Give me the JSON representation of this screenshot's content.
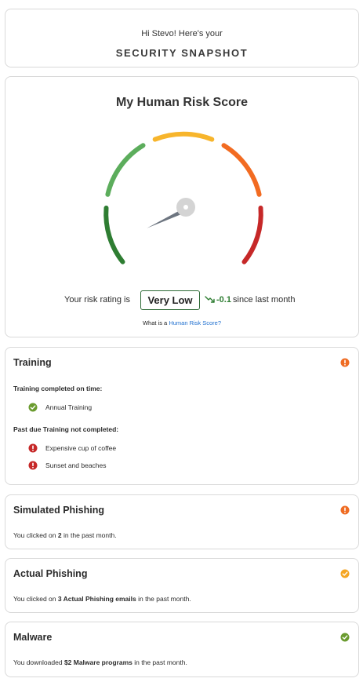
{
  "header": {
    "greeting": "Hi Stevo! Here's your",
    "title": "SECURITY SNAPSHOT"
  },
  "risk": {
    "title": "My Human Risk Score",
    "rating_label": "Your risk rating is",
    "rating_value": "Very Low",
    "trend_delta": "-0.1",
    "trend_suffix": "since last month",
    "help_prefix": "What is a",
    "help_link": "Human Risk Score?",
    "gauge_colors": [
      "#2e7d32",
      "#5cad5c",
      "#f7b52c",
      "#f26b21",
      "#c62828"
    ]
  },
  "training": {
    "title": "Training",
    "status": "warning-orange",
    "completed_heading": "Training completed on time:",
    "completed_items": [
      "Annual Training"
    ],
    "pastdue_heading": "Past due Training not completed:",
    "pastdue_items": [
      "Expensive cup of coffee",
      "Sunset and beaches"
    ]
  },
  "simulated_phishing": {
    "title": "Simulated Phishing",
    "status": "warning-orange",
    "text_pre": "You clicked on",
    "text_bold": "2",
    "text_post": "in the past month."
  },
  "actual_phishing": {
    "title": "Actual Phishing",
    "status": "check-amber",
    "text_pre": "You clicked on",
    "text_bold": "3 Actual Phishing emails",
    "text_post": "in the past month."
  },
  "malware": {
    "title": "Malware",
    "status": "check-green",
    "text_pre": "You downloaded",
    "text_bold": "$2 Malware programs",
    "text_post": "in the past month."
  },
  "colors": {
    "warning_orange": "#ef6c23",
    "check_green": "#6a9b2f",
    "check_amber": "#f5a623",
    "error_red": "#c62828",
    "positive_green": "#2e7d32",
    "link_blue": "#1f6fcf"
  }
}
